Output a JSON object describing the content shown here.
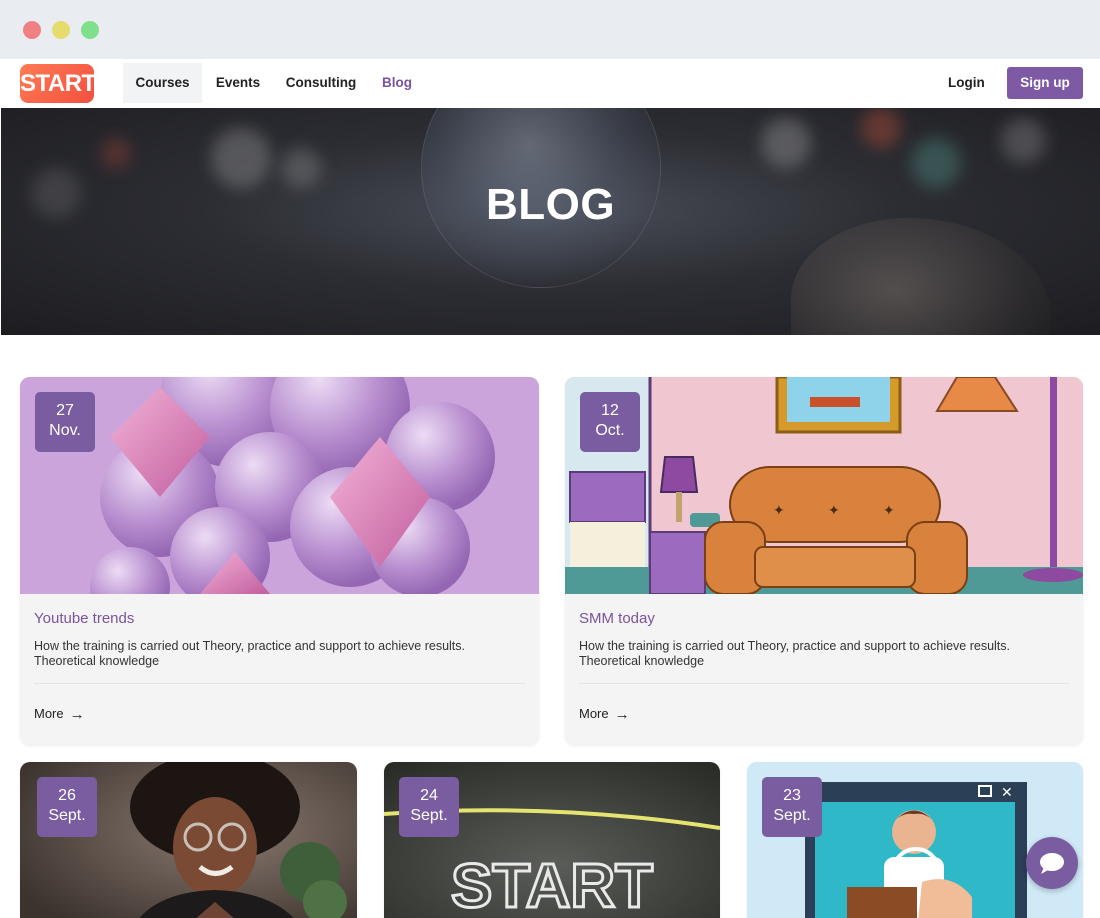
{
  "nav": {
    "logo": "START",
    "items": [
      {
        "label": "Courses"
      },
      {
        "label": "Events"
      },
      {
        "label": "Consulting"
      },
      {
        "label": "Blog"
      }
    ],
    "login": "Login",
    "signup": "Sign up"
  },
  "hero": {
    "title": "BLOG"
  },
  "posts": [
    {
      "day": "27",
      "month": "Nov.",
      "title": "Youtube trends",
      "desc": "How the training is carried out Theory, practice and support to achieve results. Theoretical knowledge",
      "more": "More"
    },
    {
      "day": "12",
      "month": "Oct.",
      "title": "SMM today",
      "desc": "How the training is carried out Theory, practice and support to achieve results. Theoretical knowledge",
      "more": "More"
    },
    {
      "day": "26",
      "month": "Sept."
    },
    {
      "day": "24",
      "month": "Sept.",
      "image_text": "START"
    },
    {
      "day": "23",
      "month": "Sept."
    }
  ],
  "colors": {
    "accent": "#7a5ca0",
    "link": "#7a549c",
    "logo": "#f2503f"
  }
}
